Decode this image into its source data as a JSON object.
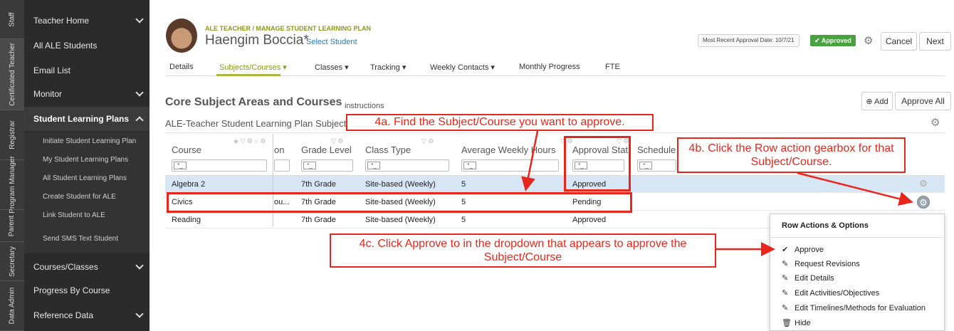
{
  "rail": [
    "Staff",
    "Certificated Teacher",
    "Registrar",
    "Program Manager",
    "Parent",
    "Secretary",
    "Data Admin"
  ],
  "sidebar": {
    "items": [
      {
        "label": "Teacher Home",
        "chevron": "down"
      },
      {
        "label": "All ALE Students"
      },
      {
        "label": "Email List"
      },
      {
        "label": "Monitor",
        "chevron": "down"
      },
      {
        "label": "Student Learning Plans",
        "chevron": "up"
      },
      {
        "label": "Courses/Classes",
        "chevron": "down"
      },
      {
        "label": "Progress By Course"
      },
      {
        "label": "Reference Data",
        "chevron": "down"
      }
    ],
    "subitems": [
      "Initiate Student Learning Plan",
      "My Student Learning Plans",
      "All Student Learning Plans",
      "Create Student for ALE",
      "Link Student to ALE",
      "Send SMS Text Student"
    ]
  },
  "header": {
    "breadcrumb": "ALE TEACHER / MANAGE STUDENT LEARNING PLAN",
    "student_name": "Haengim Boccia*",
    "select_student": "Select Student",
    "approval_date": "Most Recent Approval Date: 10/7/21",
    "approved_badge": "✔ Approved",
    "cancel": "Cancel",
    "next": "Next"
  },
  "tabs": [
    "Details",
    "Subjects/Courses ▾",
    "Classes ▾",
    "Tracking ▾",
    "Weekly Contacts ▾",
    "Monthly Progress",
    "FTE"
  ],
  "section": {
    "title": "Core Subject Areas and Courses",
    "instructions": "instructions",
    "add": "⊕ Add",
    "approve_all": "Approve All",
    "subtitle": "ALE-Teacher Student Learning Plan Subject"
  },
  "grid": {
    "columns": [
      "Course",
      "on",
      "Grade Level",
      "Class Type",
      "Average Weekly Hours",
      "Approval Stat",
      "Schedule"
    ],
    "filter_op": "*_",
    "rows": [
      {
        "course": "Algebra 2",
        "desc": "",
        "grade": "7th Grade",
        "type": "Site-based (Weekly)",
        "hours": "5",
        "status": "Approved"
      },
      {
        "course": "Civics",
        "desc": "ou...",
        "grade": "7th Grade",
        "type": "Site-based (Weekly)",
        "hours": "5",
        "status": "Pending"
      },
      {
        "course": "Reading",
        "desc": "",
        "grade": "7th Grade",
        "type": "Site-based (Weekly)",
        "hours": "5",
        "status": "Approved"
      }
    ]
  },
  "menu": {
    "title": "Row Actions & Options",
    "items": [
      {
        "icon": "check-icon",
        "glyph": "✔",
        "label": "Approve"
      },
      {
        "icon": "pencil-icon",
        "glyph": "✎",
        "label": "Request Revisions"
      },
      {
        "icon": "pencil-icon",
        "glyph": "✎",
        "label": "Edit Details"
      },
      {
        "icon": "pencil-icon",
        "glyph": "✎",
        "label": "Edit Activities/Objectives"
      },
      {
        "icon": "pencil-icon",
        "glyph": "✎",
        "label": "Edit Timelines/Methods for Evaluation"
      },
      {
        "icon": "trash-icon",
        "glyph": "🗑",
        "label": "Hide"
      }
    ]
  },
  "annotations": {
    "a": "4a. Find the Subject/Course you want to approve.",
    "b": "4b. Click the Row action gearbox for that Subject/Course.",
    "c": "4c. Click Approve to in the dropdown that appears to approve the Subject/Course"
  },
  "colors": {
    "accent": "#8a9a1a",
    "annotation": "#e8261b",
    "approved": "#47a23f",
    "sidebar": "#2b2b2b"
  }
}
